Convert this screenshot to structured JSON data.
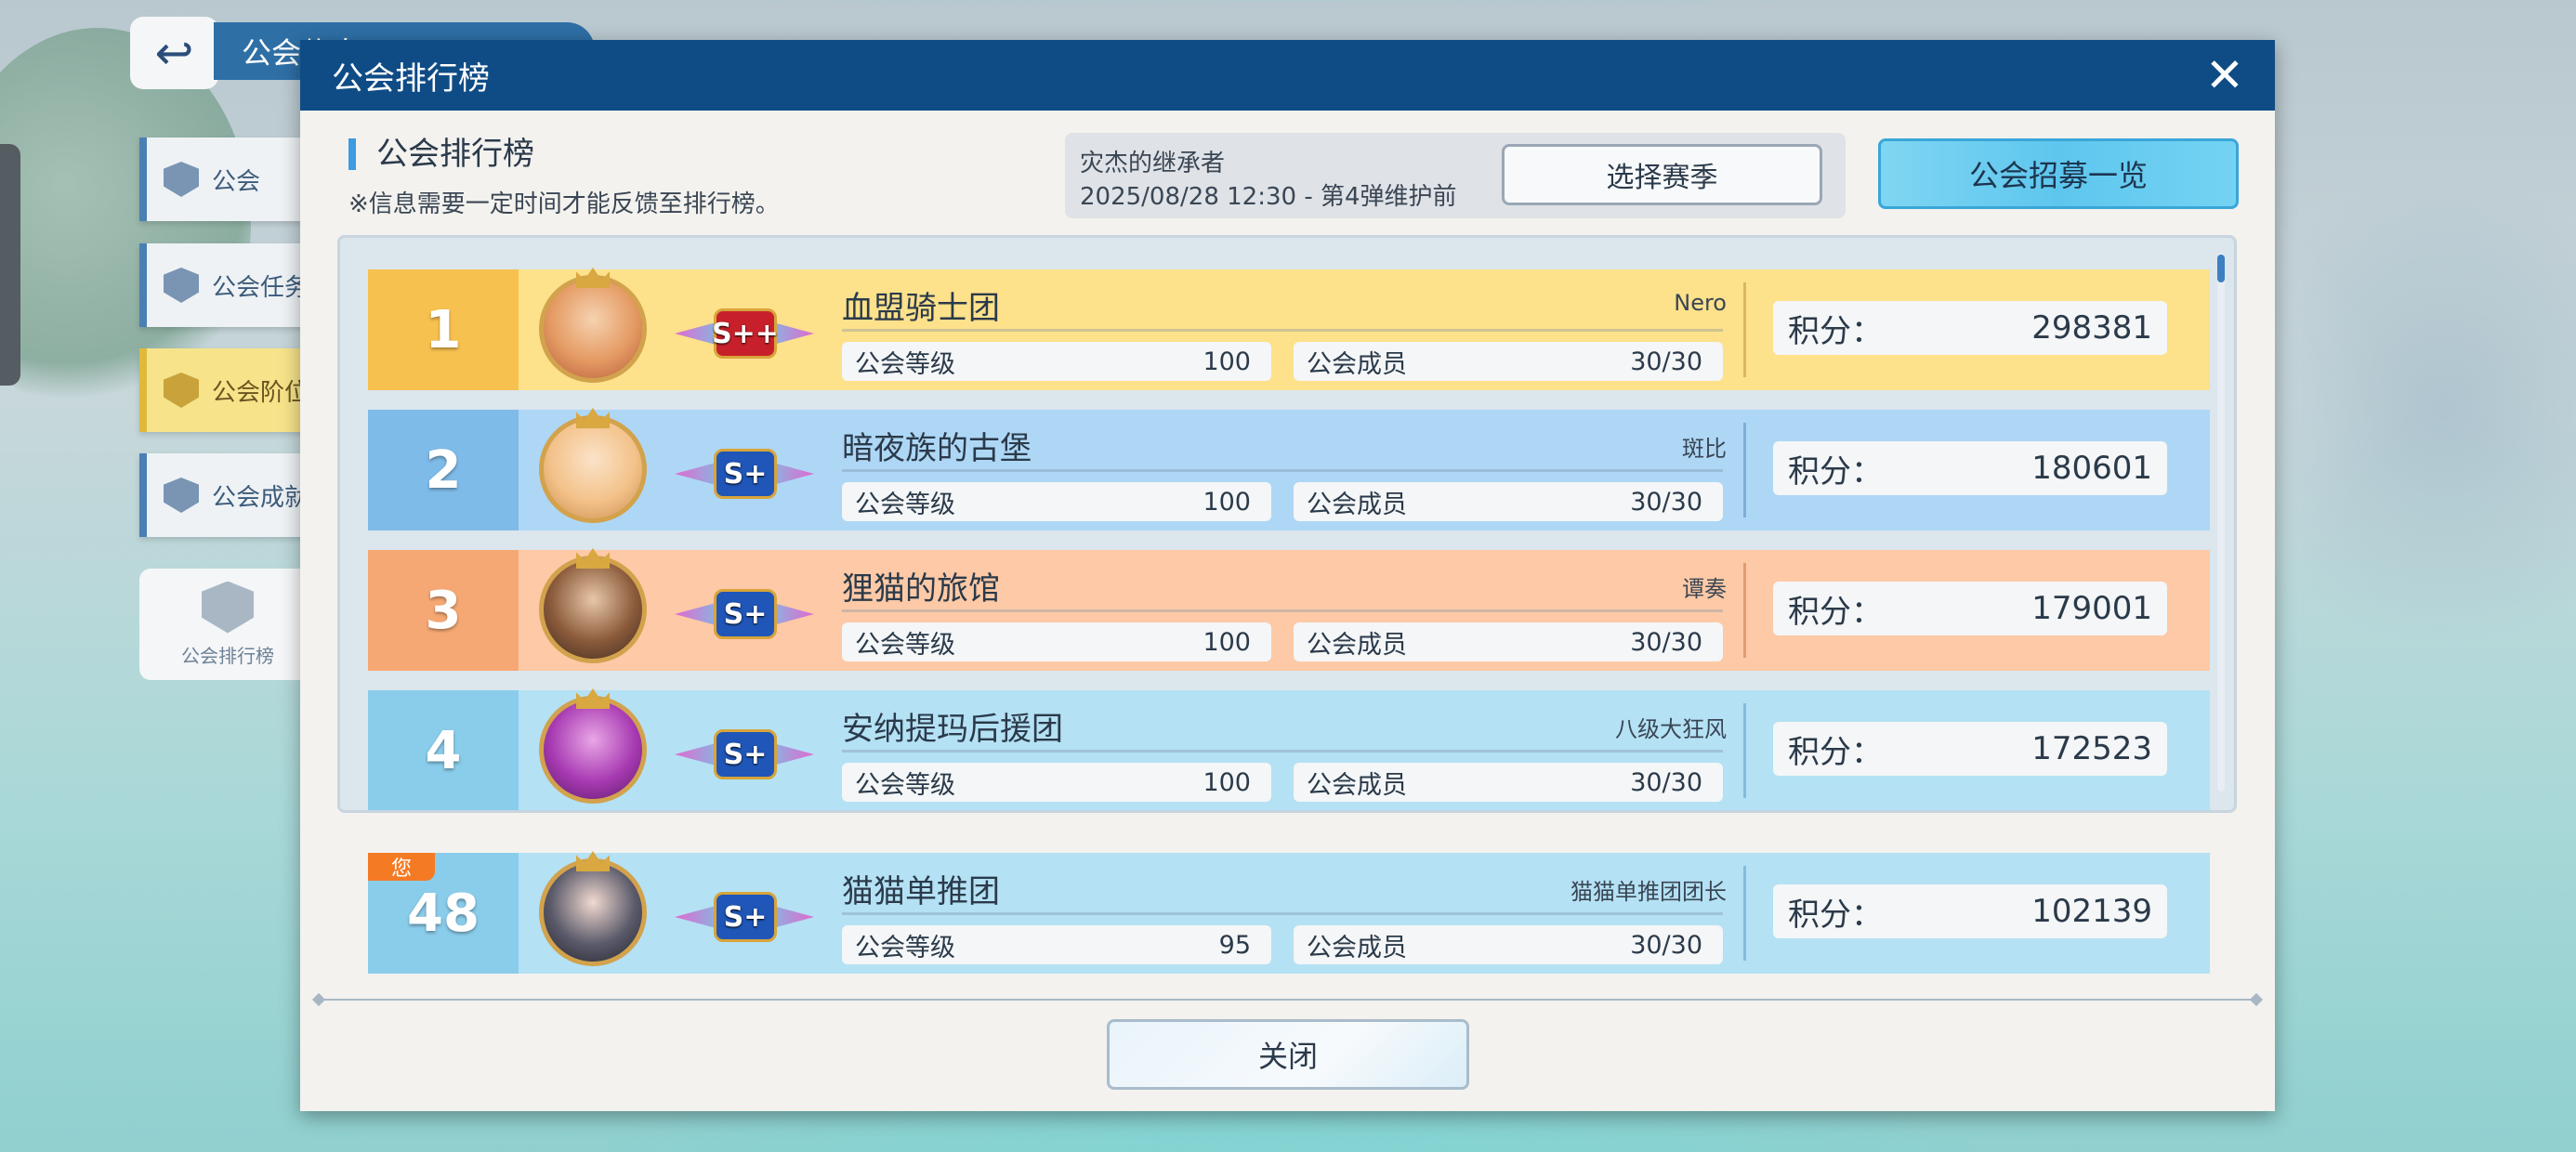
{
  "background_menu": {
    "top_tab_label": "公会信息",
    "items": [
      {
        "label": "公会"
      },
      {
        "label": "公会任务"
      },
      {
        "label": "公会阶位"
      },
      {
        "label": "公会成就"
      }
    ],
    "bottom_label": "公会排行榜"
  },
  "modal": {
    "title": "公会排行榜",
    "close_icon": "close-icon",
    "subtitle": "公会排行榜",
    "note": "※信息需要一定时间才能反馈至排行榜。",
    "season": {
      "name": "灾杰的继承者",
      "date": "2025/08/28 12:30 - 第4弹维护前",
      "select_button": "选择赛季"
    },
    "recruit_button": "公会招募一览",
    "labels": {
      "level": "公会等级",
      "members": "公会成员",
      "score": "积分："
    },
    "rows": [
      {
        "rank": "1",
        "name": "血盟骑士团",
        "leader": "Nero",
        "level": "100",
        "members": "30/30",
        "score": "298381",
        "badge": "S++",
        "badge_color": "#c8202a"
      },
      {
        "rank": "2",
        "name": "暗夜族的古堡",
        "leader": "斑比",
        "level": "100",
        "members": "30/30",
        "score": "180601",
        "badge": "S+",
        "badge_color": "#1f56b8"
      },
      {
        "rank": "3",
        "name": "狸猫的旅馆",
        "leader": "谭奏",
        "level": "100",
        "members": "30/30",
        "score": "179001",
        "badge": "S+",
        "badge_color": "#1f56b8"
      },
      {
        "rank": "4",
        "name": "安纳提玛后援团",
        "leader": "八级大狂风",
        "level": "100",
        "members": "30/30",
        "score": "172523",
        "badge": "S+",
        "badge_color": "#1f56b8"
      }
    ],
    "my_row": {
      "you_tag": "您",
      "rank": "48",
      "name": "猫猫单推团",
      "leader": "猫猫单推团团长",
      "level": "95",
      "members": "30/30",
      "score": "102139",
      "badge": "S+"
    },
    "close_button": "关闭"
  },
  "colors": {
    "header": "#0f4c86",
    "rank1": "#fde18b",
    "rank2": "#aed7f6",
    "rank3": "#fdc9a6",
    "rank4": "#b4e1f4",
    "you_tag": "#f57a24"
  }
}
